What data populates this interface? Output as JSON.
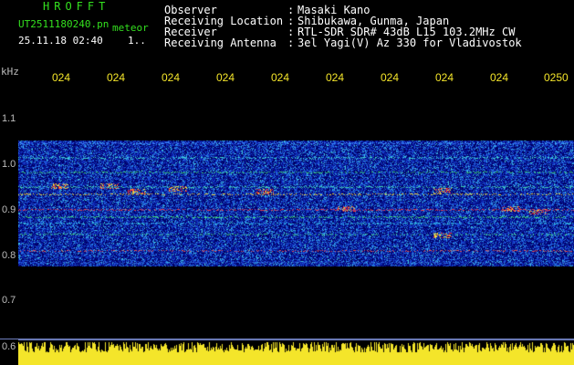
{
  "header": {
    "logo": "HROFFT",
    "file_name": "UT2511180240.pn",
    "meteor_label": "meteor",
    "date_time": "25.11.18 02:40",
    "counter": "1..",
    "info": [
      {
        "label": "Observer",
        "value": "Masaki Kano"
      },
      {
        "label": "Receiving Location",
        "value": "Shibukawa, Gunma, Japan"
      },
      {
        "label": "Receiver",
        "value": "RTL-SDR SDR# 43dB L15 103.2MHz CW"
      },
      {
        "label": "Receiving Antenna",
        "value": "3el Yagi(V) Az 330 for Vladivostok"
      }
    ],
    "colon": ":"
  },
  "axes": {
    "y_unit": "kHz",
    "y_ticks": [
      "1.1",
      "1.0",
      "0.9",
      "0.8",
      "0.7",
      "0.6"
    ],
    "x_ticks": [
      "024",
      "024",
      "024",
      "024",
      "024",
      "024",
      "024",
      "024",
      "024",
      "0250"
    ]
  },
  "colors": {
    "header_text": "#34e11f",
    "info_text": "#ffffff",
    "time_ticks": "#f4e52a",
    "freq_ticks": "#bdbdbd",
    "spectrogram_background": "#00008c",
    "volume_bar": "#f4e52a"
  }
}
